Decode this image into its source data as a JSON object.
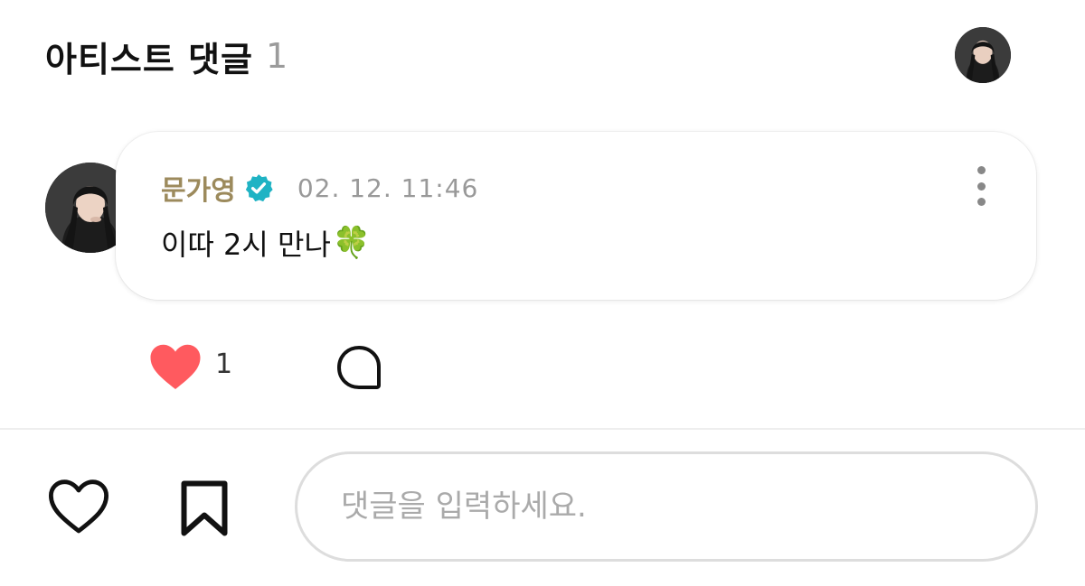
{
  "header": {
    "title": "아티스트 댓글",
    "count": "1"
  },
  "comment": {
    "author": "문가영",
    "timestamp": "02. 12. 11:46",
    "text": "이따 2시 만나",
    "emoji": "🍀",
    "like_count": "1",
    "icons": {
      "verified": "verified-badge-icon",
      "more": "more-vertical-icon",
      "like": "heart-filled-icon",
      "reply": "chat-bubble-icon"
    }
  },
  "bottom_bar": {
    "input_placeholder": "댓글을 입력하세요.",
    "input_value": "",
    "icons": {
      "like": "heart-outline-icon",
      "bookmark": "bookmark-icon"
    }
  },
  "colors": {
    "author": "#9c8a5c",
    "verified": "#1fb3c4",
    "like": "#ff5a5f",
    "muted": "#999999"
  }
}
